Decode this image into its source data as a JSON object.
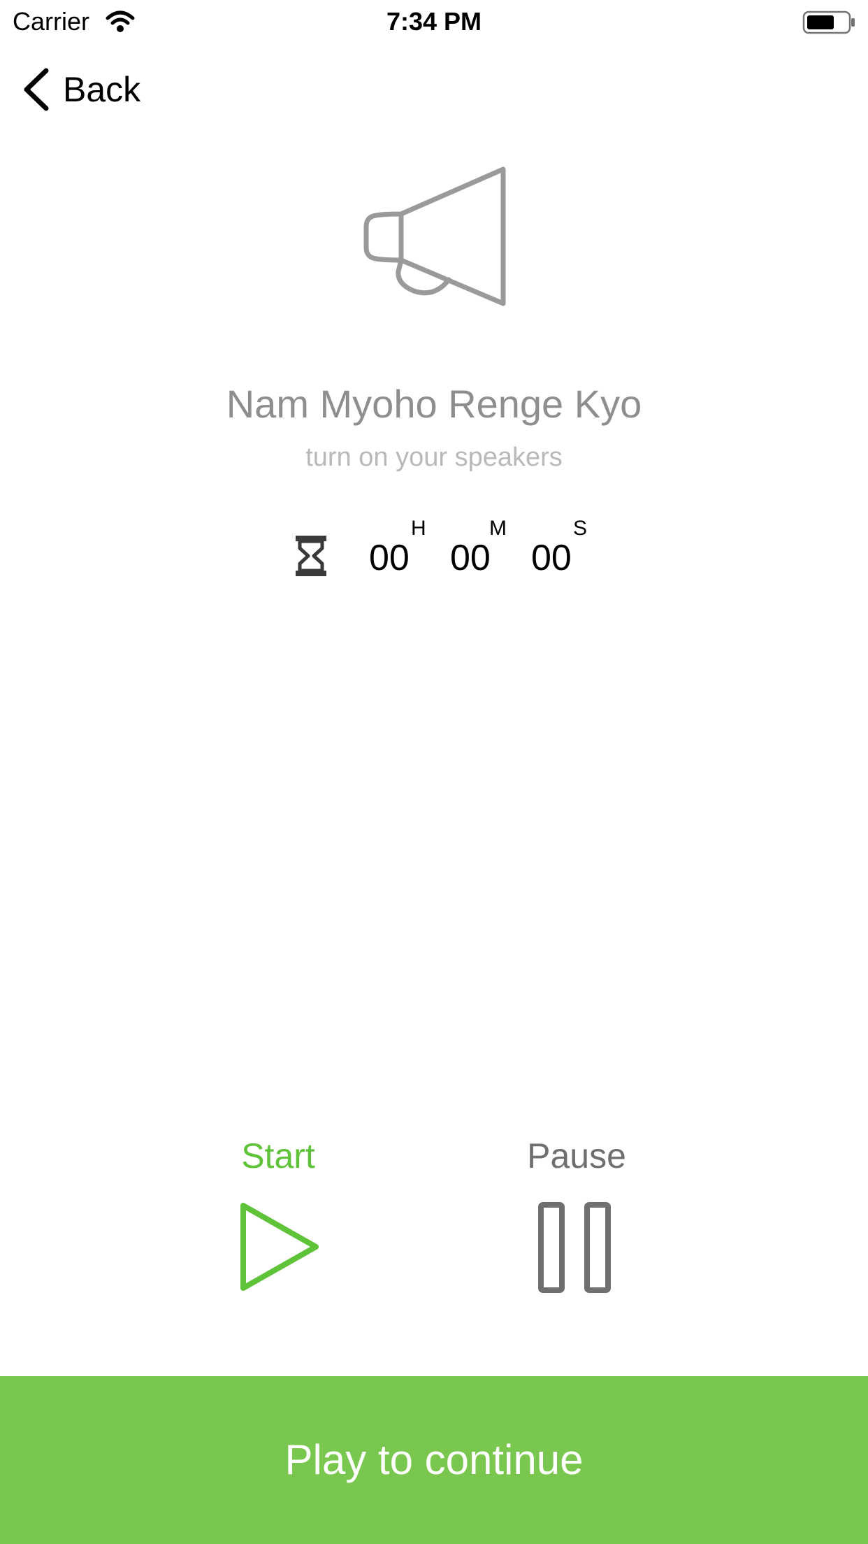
{
  "status_bar": {
    "carrier": "Carrier",
    "time": "7:34 PM",
    "icons": [
      "wifi-icon",
      "battery-icon"
    ]
  },
  "nav": {
    "back_label": "Back",
    "back_icon": "chevron-left-icon"
  },
  "hero": {
    "icon": "megaphone-icon",
    "title": "Nam Myoho Renge Kyo",
    "subtitle": "turn on your speakers"
  },
  "timer": {
    "icon": "hourglass-icon",
    "hours": "00",
    "hours_unit": "H",
    "minutes": "00",
    "minutes_unit": "M",
    "seconds": "00",
    "seconds_unit": "S"
  },
  "controls": {
    "start_label": "Start",
    "start_icon": "play-icon",
    "pause_label": "Pause",
    "pause_icon": "pause-icon"
  },
  "footer": {
    "button_label": "Play to continue"
  },
  "colors": {
    "accent_green": "#79c74e",
    "start_green": "#5fc33a",
    "title_gray": "#8e8e8e",
    "subtitle_gray": "#b9b9b9",
    "icon_gray": "#9a9a9a",
    "pause_gray": "#6f6f6f"
  }
}
